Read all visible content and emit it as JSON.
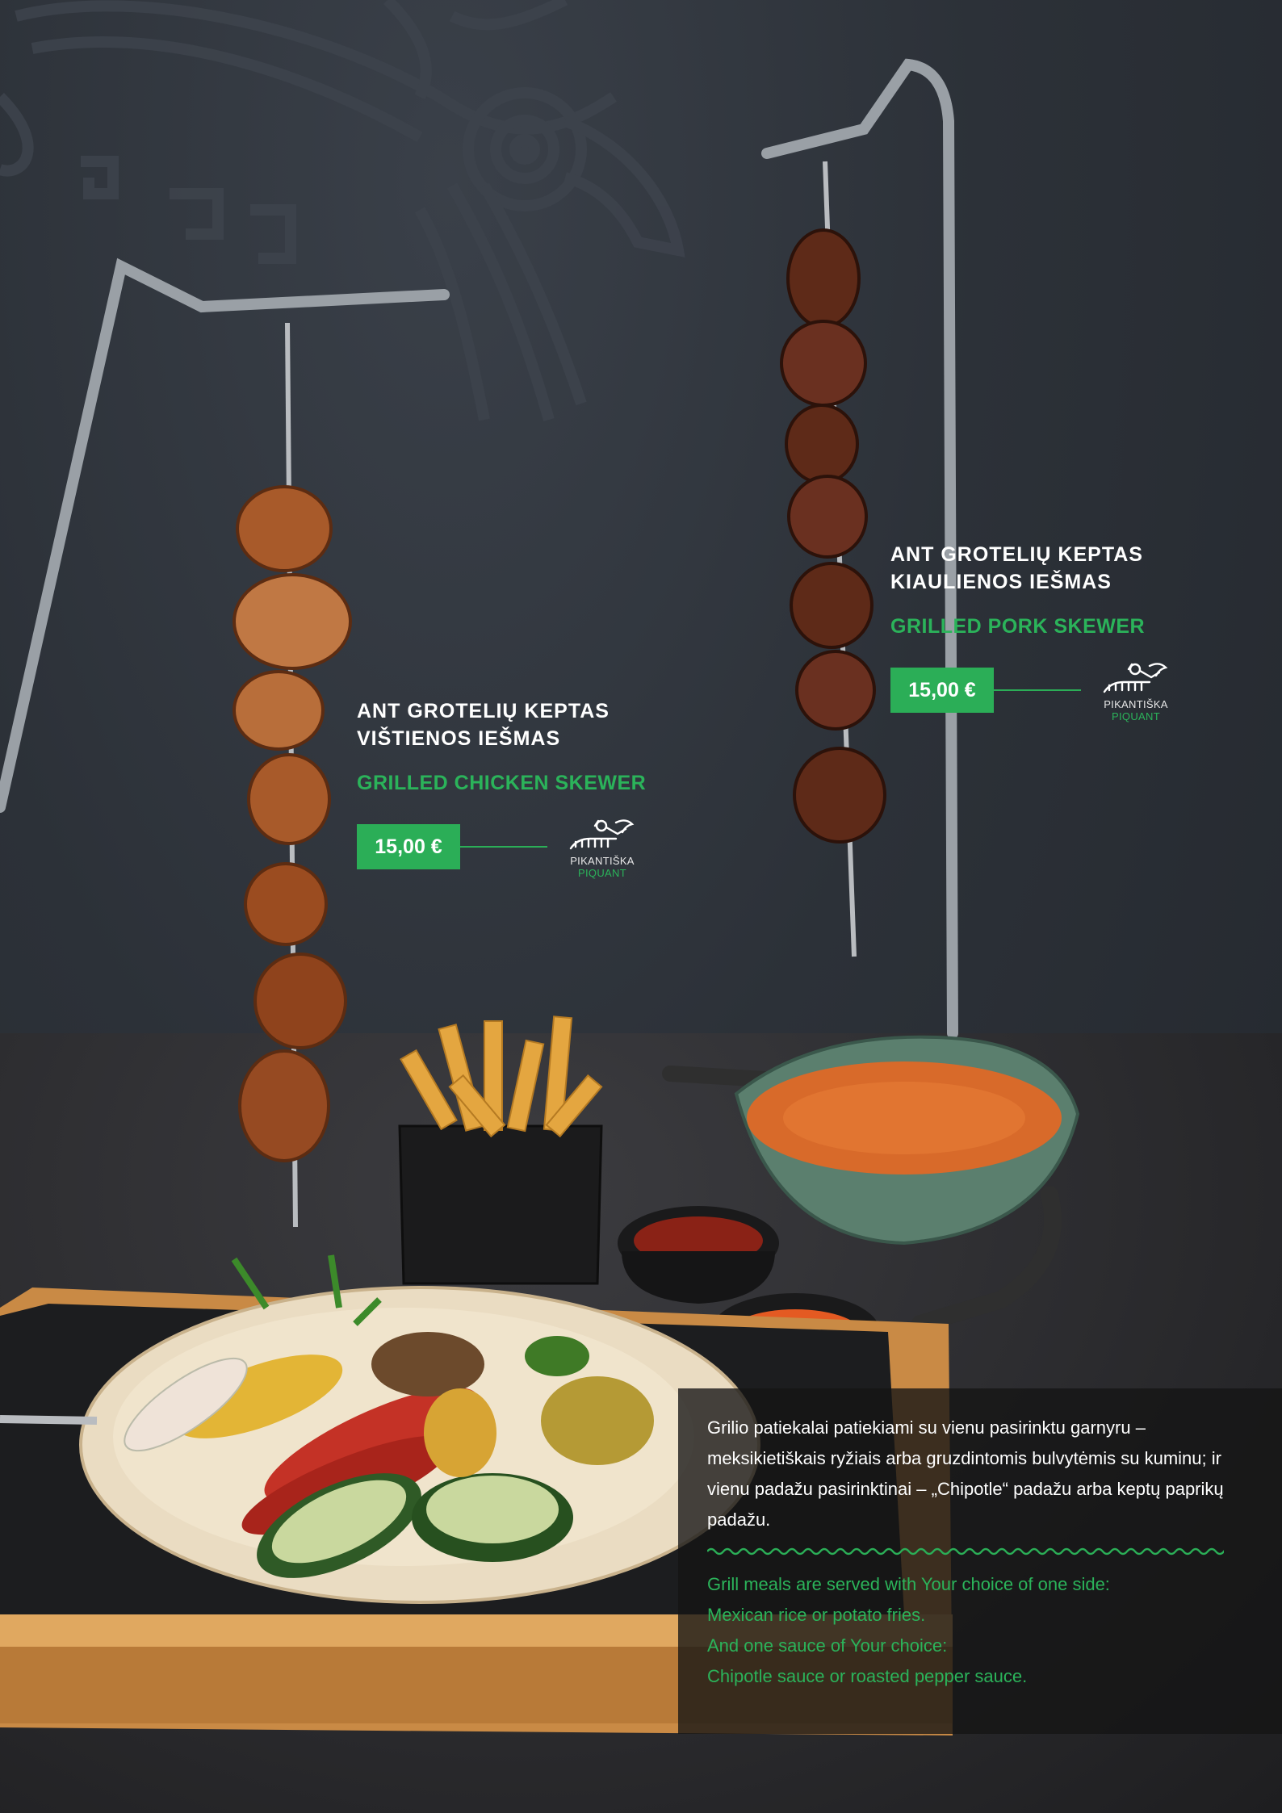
{
  "items": [
    {
      "title_lt_line1": "ANT GROTELIŲ KEPTAS",
      "title_lt_line2": "KIAULIENOS IEŠMAS",
      "title_en": "GRILLED PORK SKEWER",
      "price": "15,00 €",
      "spice_lt": "PIKANTIŠKA",
      "spice_en": "PIQUANT"
    },
    {
      "title_lt_line1": "ANT GROTELIŲ KEPTAS",
      "title_lt_line2": "VIŠTIENOS IEŠMAS",
      "title_en": "GRILLED CHICKEN SKEWER",
      "price": "15,00 €",
      "spice_lt": "PIKANTIŠKA",
      "spice_en": "PIQUANT"
    }
  ],
  "info": {
    "lt": "Grilio patiekalai patiekiami su vienu pasirinktu garnyru – meksikietiškais ryžiais arba gruzdintomis bulvytėmis su kuminu; ir vienu padažu pasirinktinai – „Chipotle“ padažu arba keptų paprikų padažu.",
    "en_line1": "Grill meals are served with Your choice of one side:",
    "en_line2": "Mexican rice or potato fries.",
    "en_line3": "And one sauce of Your choice:",
    "en_line4": "Chipotle sauce or roasted pepper sauce."
  },
  "colors": {
    "accent_green": "#2bae57",
    "background": "#2c3138"
  },
  "icons": [
    "chili-bird-icon"
  ]
}
